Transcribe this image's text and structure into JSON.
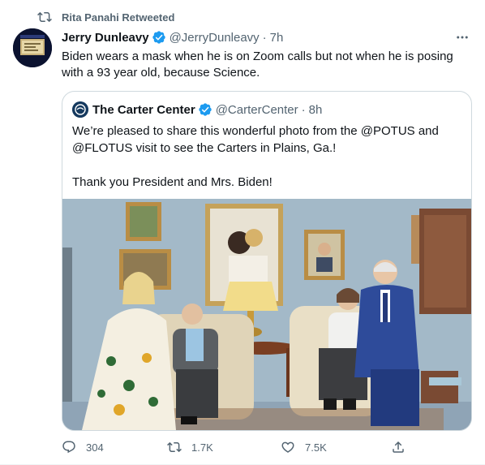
{
  "retweet_banner": {
    "text": "Rita Panahi Retweeted",
    "icon": "retweet-icon"
  },
  "tweet": {
    "author_name": "Jerry Dunleavy",
    "author_handle": "@JerryDunleavy",
    "separator": "·",
    "time": "7h",
    "verified": true,
    "text": "Biden wears a mask when he is on Zoom calls but not when he is posing with a 93 year old, because Science."
  },
  "quote": {
    "author_name": "The Carter Center",
    "author_handle": "@CarterCenter",
    "separator": "·",
    "time": "8h",
    "verified": true,
    "text": "We’re pleased to share this wonderful photo from the @POTUS and @FLOTUS visit to see the Carters in Plains, Ga.!\n\nThank you President and Mrs. Biden!"
  },
  "actions": {
    "reply_count": "304",
    "retweet_count": "1.7K",
    "like_count": "7.5K"
  },
  "colors": {
    "text_primary": "#0f1419",
    "text_secondary": "#536471",
    "verified_blue": "#1d9bf0",
    "border": "#cfd9de"
  }
}
